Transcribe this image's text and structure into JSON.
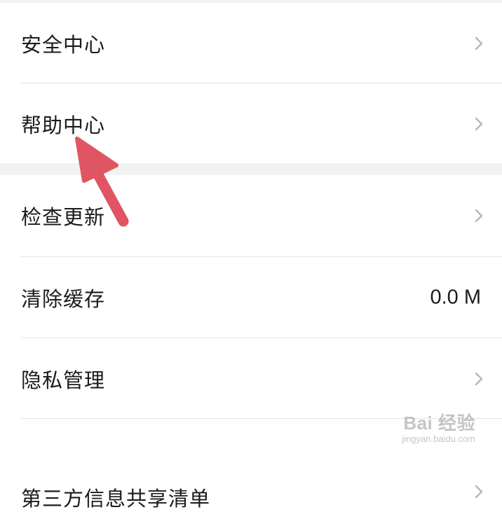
{
  "settings": {
    "section1": [
      {
        "label": "安全中心",
        "icon": "chevron-right-icon"
      },
      {
        "label": "帮助中心",
        "icon": "chevron-right-icon"
      }
    ],
    "section2": [
      {
        "label": "检查更新",
        "icon": "chevron-right-icon"
      },
      {
        "label": "清除缓存",
        "value": "0.0 M"
      },
      {
        "label": "隐私管理",
        "icon": "chevron-right-icon"
      },
      {
        "label": "第三方信息共享清单",
        "icon": "chevron-right-icon"
      }
    ]
  },
  "annotation": {
    "arrow_color": "#e05563",
    "arrow_target": "帮助中心"
  },
  "watermark": {
    "main": "Bai 经验",
    "sub": "jingyan.baidu.com"
  },
  "colors": {
    "background": "#ffffff",
    "section_gap": "#f2f2f2",
    "divider": "#e4e4e4",
    "text": "#1b1b1b",
    "chevron": "#b5b5b5"
  }
}
